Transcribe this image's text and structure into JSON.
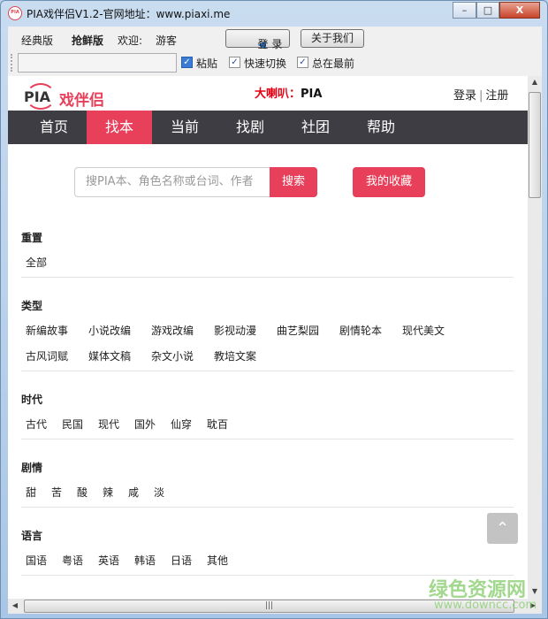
{
  "window": {
    "title": "PIA戏伴侣V1.2-官网地址：www.piaxi.me",
    "icon_text": "PIA",
    "minimize": "–",
    "maximize": "□",
    "close": "X"
  },
  "toolbar": {
    "classic": "经典版",
    "fresh": "抢鲜版",
    "welcome": "欢迎:",
    "user": "游客",
    "login": "登 录",
    "about": "关于我们",
    "input_value": "",
    "checks": [
      {
        "label": "粘贴",
        "checked": true
      },
      {
        "label": "快速切换",
        "checked": true
      },
      {
        "label": "总在最前",
        "checked": true
      }
    ]
  },
  "site": {
    "logo_pia": "PIA",
    "logo_cn": "戏伴侣",
    "horn_label": "大喇叭：",
    "horn_value": "PIA",
    "login": "登录",
    "sep": "|",
    "register": "注册",
    "nav": [
      "首页",
      "找本",
      "当前",
      "找剧",
      "社团",
      "帮助"
    ],
    "nav_active": 1,
    "search_placeholder": "搜PIA本、角色名称或台词、作者",
    "search_btn": "搜索",
    "favorites_btn": "我的收藏",
    "sections": [
      {
        "title": "重置",
        "items": [
          "全部"
        ]
      },
      {
        "title": "类型",
        "items": [
          "新编故事",
          "小说改编",
          "游戏改编",
          "影视动漫",
          "曲艺梨园",
          "剧情轮本",
          "现代美文",
          "古风词赋",
          "媒体文稿",
          "杂文小说",
          "教培文案"
        ]
      },
      {
        "title": "时代",
        "items": [
          "古代",
          "民国",
          "现代",
          "国外",
          "仙穿",
          "耽百"
        ]
      },
      {
        "title": "剧情",
        "items": [
          "甜",
          "苦",
          "酸",
          "辣",
          "咸",
          "淡"
        ]
      },
      {
        "title": "语言",
        "items": [
          "国语",
          "粤语",
          "英语",
          "韩语",
          "日语",
          "其他"
        ]
      }
    ],
    "to_top": "⌃"
  },
  "watermark": {
    "cn": "绿色资源网",
    "url": "www.downcc.com"
  },
  "colors": {
    "accent": "#e8405a",
    "nav_bg": "#3e3d43"
  }
}
